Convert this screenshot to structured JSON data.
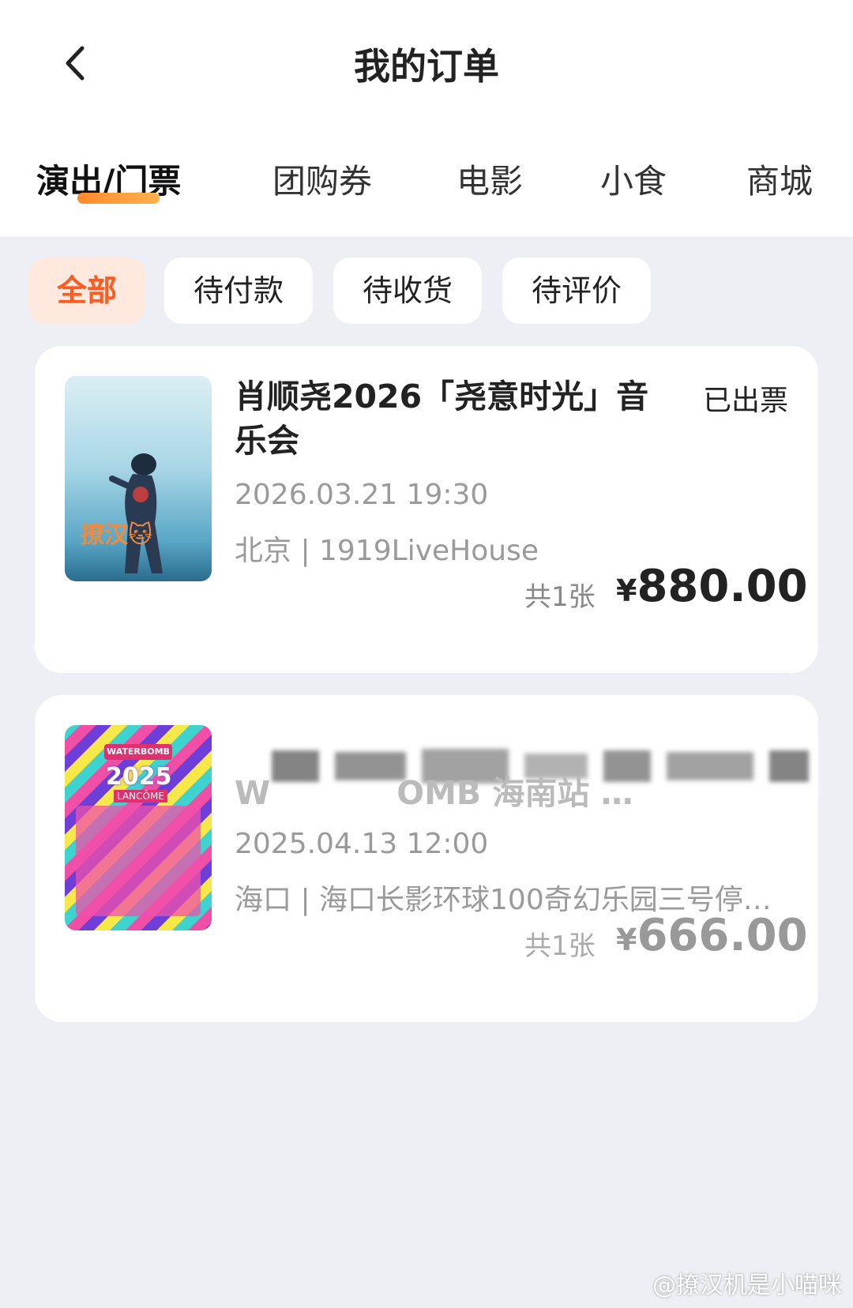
{
  "header": {
    "title": "我的订单",
    "back_icon": "chevron-left-icon"
  },
  "tabs": [
    {
      "label": "演出/门票",
      "active": true
    },
    {
      "label": "团购券",
      "active": false
    },
    {
      "label": "电影",
      "active": false
    },
    {
      "label": "小食",
      "active": false
    },
    {
      "label": "商城",
      "active": false
    }
  ],
  "filters": [
    {
      "label": "全部",
      "active": true
    },
    {
      "label": "待付款",
      "active": false
    },
    {
      "label": "待收货",
      "active": false
    },
    {
      "label": "待评价",
      "active": false
    }
  ],
  "orders": [
    {
      "title": "肖顺尧2026「尧意时光」音乐会",
      "status": "已出票",
      "datetime": "2026.03.21 19:30",
      "venue": "北京 | 1919LiveHouse",
      "count": "共1张",
      "price": "880.00",
      "currency": "¥",
      "poster_overlay": "撩汉🐱"
    },
    {
      "title_partial": "W",
      "title_tail": "OMB 海南站 …",
      "datetime": "2025.04.13 12:00",
      "venue": "海口 | 海口长影环球100奇幻乐园三号停…",
      "count": "共1张",
      "price": "666.00",
      "currency": "¥",
      "poster_brand": "WATERBOMB",
      "poster_year": "2025",
      "poster_sponsor": "LANCÔME"
    }
  ],
  "watermark": "@撩汉机是小喵咪",
  "colors": {
    "accent": "#ff5a1f",
    "chip_active_bg": "#ffe9df",
    "page_bg": "#edeff4"
  }
}
